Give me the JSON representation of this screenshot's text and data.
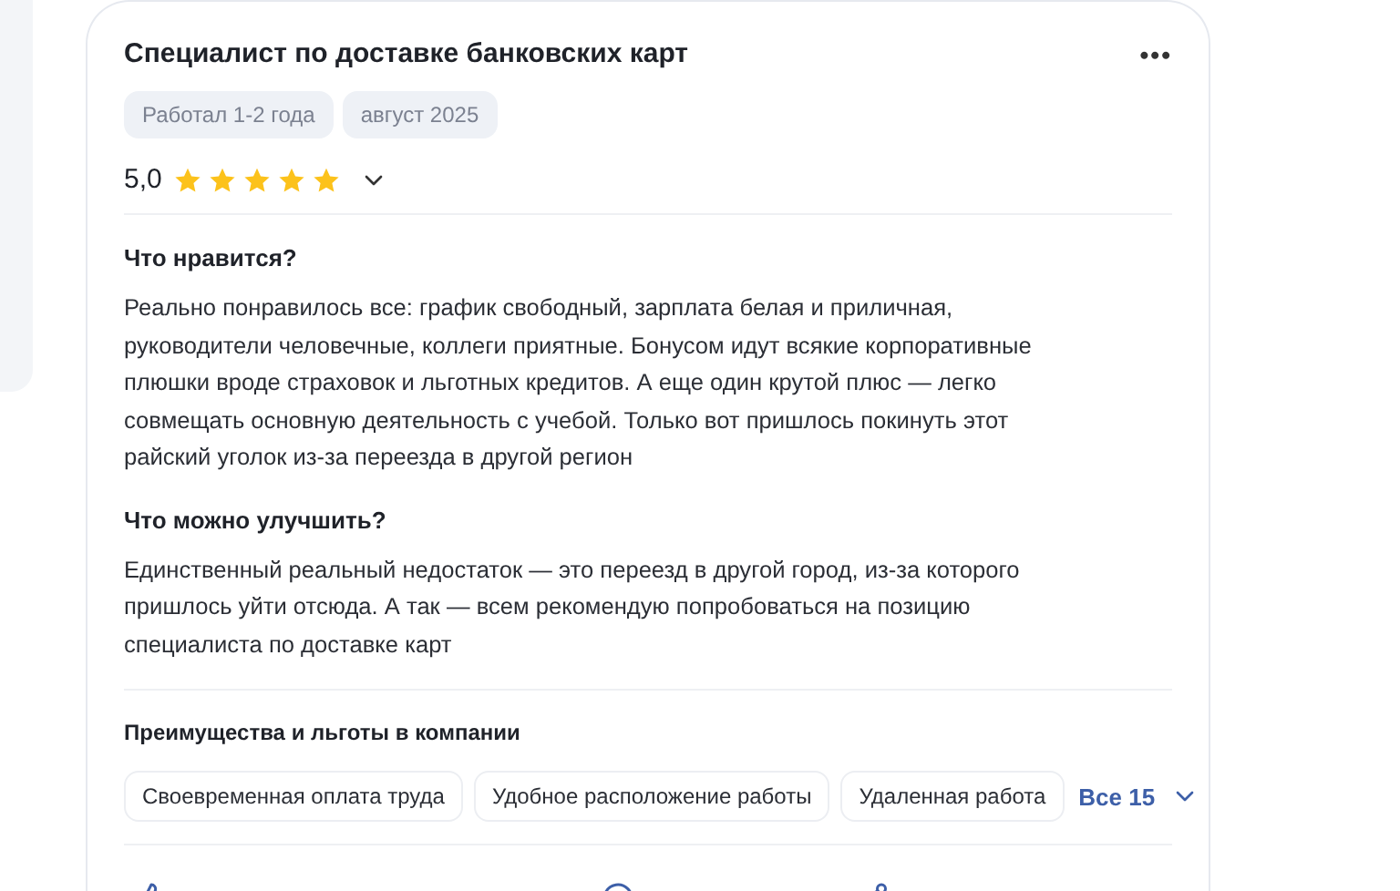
{
  "review": {
    "title": "Специалист по доставке банковских карт",
    "menu_icon": "•••",
    "tags": [
      "Работал 1-2 года",
      "август 2025"
    ],
    "rating": {
      "value": "5,0",
      "stars": 5,
      "expanded": false
    },
    "sections": [
      {
        "heading": "Что нравится?",
        "text": "Реально понравилось все: график свободный, зарплата белая и приличная, руководители человечные, коллеги приятные. Бонусом идут всякие корпоративные плюшки вроде страховок и льготных кредитов. А еще один крутой плюс — легко совмещать основную деятельность с учебой. Только вот пришлось покинуть этот райский уголок из-за переезда в другой регион"
      },
      {
        "heading": "Что можно улучшить?",
        "text": "Единственный реальный недостаток — это переезд в другой город, из-за которого пришлось уйти отсюда. А так — всем рекомендую попробоваться на позицию специалиста по доставке карт"
      }
    ],
    "benefits": {
      "heading": "Преимущества и льготы в компании",
      "items": [
        "Своевременная оплата труда",
        "Удобное расположение работы",
        "Удаленная работа"
      ],
      "more": "Все 15"
    }
  }
}
